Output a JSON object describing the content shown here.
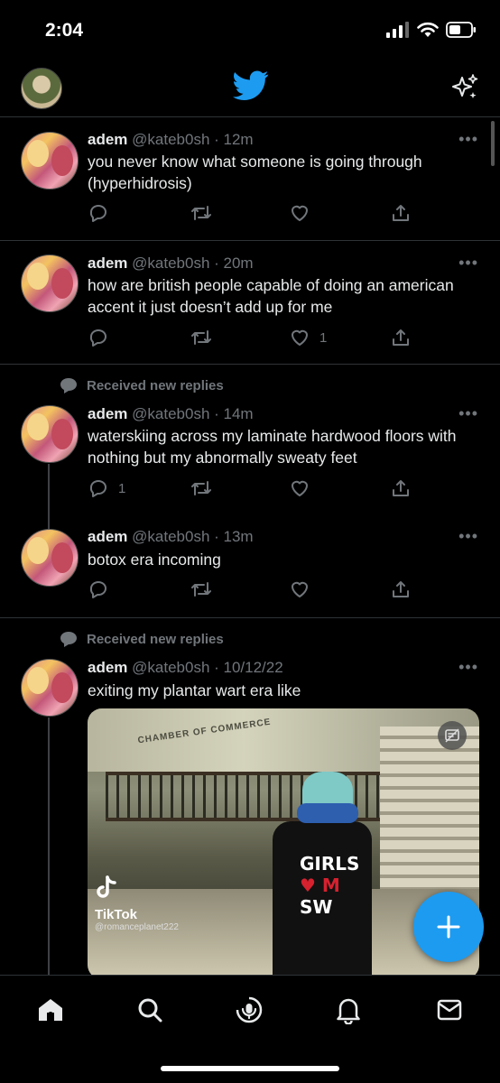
{
  "status_bar": {
    "time": "2:04"
  },
  "colors": {
    "accent": "#1d9bf0",
    "background": "#000000",
    "text": "#e7e9ea",
    "muted": "#71767b",
    "like_red": "#d6212f"
  },
  "icons": {
    "reply": "speech-bubble-icon",
    "retweet": "retweet-icon",
    "like": "heart-icon",
    "share": "share-icon",
    "more": "ellipsis-icon",
    "logo": "twitter-bird-icon",
    "sparkle": "sparkle-icon",
    "compose": "plus-icon",
    "home": "home-icon",
    "search": "search-icon",
    "spaces": "spaces-icon",
    "notifications": "bell-icon",
    "messages": "envelope-icon"
  },
  "timeline": {
    "tweets": [
      {
        "name": "adem",
        "meta": "@kateb0sh · 12m",
        "text": "you never know what someone is going through (hyperhidrosis)",
        "reply_count": "",
        "like_count": ""
      },
      {
        "name": "adem",
        "meta": "@kateb0sh · 20m",
        "text": "how are british people capable of doing an american accent it just doesn’t add up for me",
        "reply_count": "",
        "like_count": "1"
      },
      {
        "context": "Received new replies",
        "name": "adem",
        "meta": "@kateb0sh · 14m",
        "text": "waterskiing across my laminate hardwood floors with nothing but my abnormally sweaty feet",
        "reply_count": "1",
        "like_count": ""
      },
      {
        "name": "adem",
        "meta": "@kateb0sh · 13m",
        "text": "botox era incoming",
        "reply_count": "",
        "like_count": ""
      },
      {
        "context": "Received new replies",
        "name": "adem",
        "meta": "@kateb0sh · 10/12/22",
        "text": "exiting my plantar wart era like",
        "media": {
          "watermark_name": "TikTok",
          "watermark_handle": "@romanceplanet222",
          "shirt_line1": "GIRLS",
          "shirt_line2": "♥ M",
          "shirt_line3": "SW",
          "sign_text": "CHAMBER OF COMMERCE"
        }
      }
    ]
  }
}
